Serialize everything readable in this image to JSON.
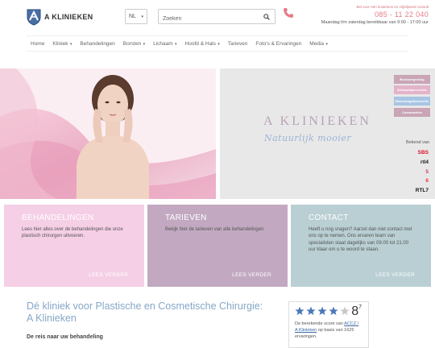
{
  "header": {
    "logo_text": "A KLINIEKEN",
    "language": "NL",
    "search_placeholder": "Zoeken",
    "contact_line1": "Bel voor een kosteloos en vrijblijvend consult",
    "phone": "085 - 11 22 040",
    "hours": "Maandag t/m zaterdag bereikbaar van 9:00 - 17:00 uur"
  },
  "nav": [
    {
      "label": "Home",
      "dropdown": false
    },
    {
      "label": "Kliniek",
      "dropdown": true
    },
    {
      "label": "Behandelingen",
      "dropdown": false
    },
    {
      "label": "Borsten",
      "dropdown": true
    },
    {
      "label": "Lichaam",
      "dropdown": true
    },
    {
      "label": "Hoofd & Hals",
      "dropdown": true
    },
    {
      "label": "Tarieven",
      "dropdown": false
    },
    {
      "label": "Foto's & Ervaringen",
      "dropdown": false
    },
    {
      "label": "Media",
      "dropdown": true
    }
  ],
  "hero": {
    "brand": "A KLINIEKEN",
    "tagline": "Natuurlijk mooier",
    "tags": [
      {
        "label": "Borstvergroting",
        "color": "#c9a5b5"
      },
      {
        "label": "Schaamlipcorrectie",
        "color": "#e2b3c9"
      },
      {
        "label": "Bovenooglidcorrectie",
        "color": "#a8c5e3"
      },
      {
        "label": "Cosmoactive",
        "color": "#c9a5b5"
      }
    ],
    "bekend_van": "Bekend van",
    "channels": [
      {
        "label": "SBS",
        "color": "#e0102b"
      },
      {
        "label": "rtl4",
        "color": "#1b1b1b"
      },
      {
        "label": "5",
        "color": "#d6337f"
      },
      {
        "label": "6",
        "color": "#e03a2f"
      },
      {
        "label": "RTL7",
        "color": "#111111"
      }
    ]
  },
  "panels": [
    {
      "title": "BEHANDELINGEN",
      "text": "Lees hier alles over de behandelingen die onze plastisch chirurgen uitvoeren.",
      "more": "LEES VERDER"
    },
    {
      "title": "TARIEVEN",
      "text": "Bekijk hier de tarieven van alle behandelingen",
      "more": "LEES VERDER"
    },
    {
      "title": "CONTACT",
      "text": "Heeft u nog vragen? Aarzel dan niet contact met ons op te nemen. Ons ervaren team van specialisten staat dagelijks van 09.00 tot 21.00 uur klaar om u te woord te staan.",
      "more": "LEES VERDER"
    }
  ],
  "main": {
    "title": "Dé kliniek voor Plastische en Cosmetische Chirurgie: A Klinieken",
    "subtitle": "De reis naar uw behandeling"
  },
  "rating": {
    "score_main": "8",
    "score_decimal": "7",
    "stars_filled": 4,
    "stars_total": 5,
    "text_prefix": "De berekende score van",
    "link_text": "ACCZ / A Klinieken",
    "text_suffix": "op basis van 1625 ervaringen.",
    "star_color": "#4a78b8"
  }
}
